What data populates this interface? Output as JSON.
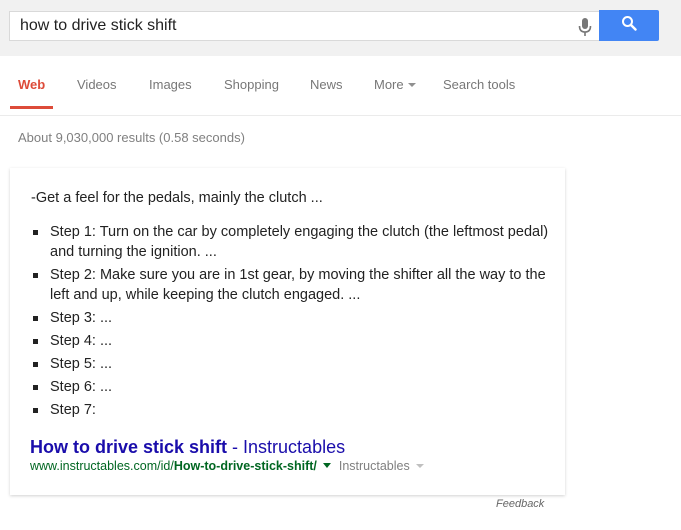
{
  "search": {
    "query": "how to drive stick shift",
    "mic_icon": "microphone-icon",
    "search_icon": "magnifier-icon",
    "button_color": "#4285f4"
  },
  "tabs": [
    {
      "label": "Web",
      "active": true
    },
    {
      "label": "Videos",
      "active": false
    },
    {
      "label": "Images",
      "active": false
    },
    {
      "label": "Shopping",
      "active": false
    },
    {
      "label": "News",
      "active": false
    },
    {
      "label": "More",
      "active": false,
      "dropdown": true
    },
    {
      "label": "Search tools",
      "active": false
    }
  ],
  "accent_color": "#dd4b39",
  "result_stats": "About 9,030,000 results (0.58 seconds)",
  "answer_card": {
    "intro": "-Get a feel for the pedals, mainly the clutch ...",
    "steps": [
      "Step 1: Turn on the car by completely engaging the clutch (the leftmost pedal) and turning the ignition. ...",
      "Step 2: Make sure you are in 1st gear, by moving the shifter all the way to the left and up, while keeping the clutch engaged. ...",
      "Step 3: ...",
      "Step 4: ...",
      "Step 5: ...",
      "Step 6: ...",
      "Step 7:"
    ],
    "result": {
      "title_bold": "How to drive stick shift",
      "title_rest": " - Instructables",
      "url_prefix": "www.instructables.com/id/",
      "url_bold": "How-to-drive-stick-shift/",
      "source": "Instructables"
    }
  },
  "feedback_label": "Feedback"
}
